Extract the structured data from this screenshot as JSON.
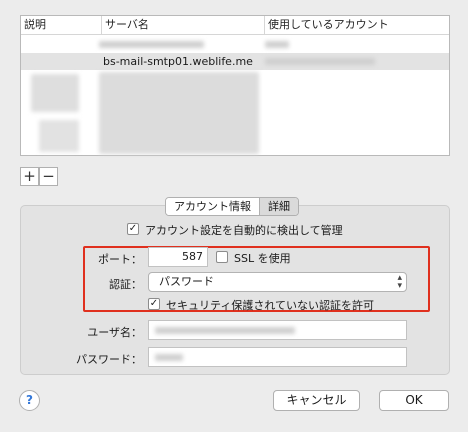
{
  "table": {
    "headers": [
      "説明",
      "サーバ名",
      "使用しているアカウント"
    ],
    "rows": [
      {
        "description": "",
        "server": "",
        "account": ""
      },
      {
        "description": "",
        "server": "bs-mail-smtp01.weblife.me",
        "account": ""
      }
    ]
  },
  "list_buttons": {
    "add": "+",
    "remove": "−"
  },
  "tabs": [
    "アカウント情報",
    "詳細"
  ],
  "auto_detect": {
    "label": "アカウント設定を自動的に検出して管理",
    "checked": true
  },
  "port": {
    "label": "ポート：",
    "value": "587"
  },
  "ssl": {
    "label": "SSL を使用",
    "checked": false
  },
  "auth": {
    "label": "認証：",
    "value": "パスワード"
  },
  "insecure_auth": {
    "label": "セキュリティ保護されていない認証を許可",
    "checked": true
  },
  "username": {
    "label": "ユーザ名：",
    "value": ""
  },
  "password": {
    "label": "パスワード：",
    "value": ""
  },
  "buttons": {
    "help": "?",
    "cancel": "キャンセル",
    "ok": "OK"
  },
  "colors": {
    "highlight_box": "#e0301e",
    "help": "#3478d8"
  }
}
